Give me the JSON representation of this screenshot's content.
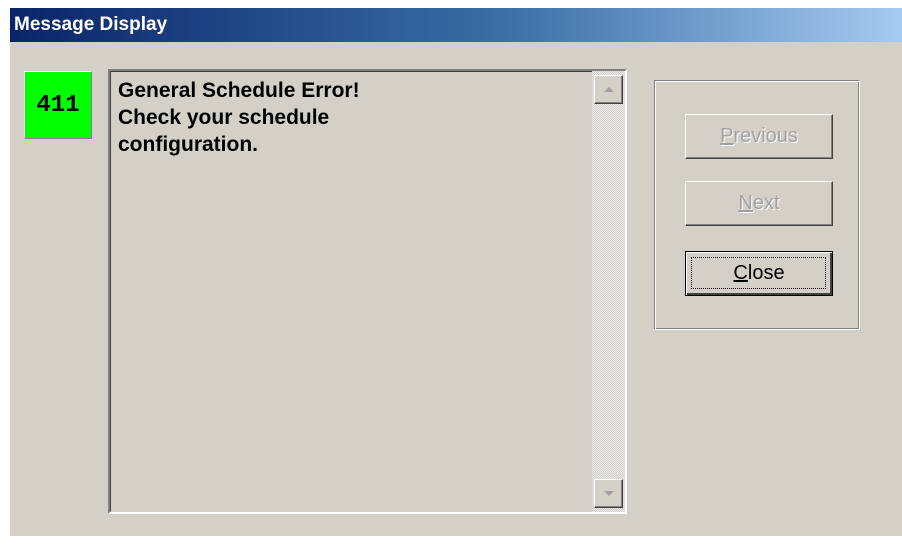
{
  "window": {
    "title": "Message Display"
  },
  "message": {
    "code": "411",
    "code_color": "#00ff00",
    "text": "General Schedule Error!\nCheck your schedule\nconfiguration."
  },
  "buttons": {
    "previous_label": "Previous",
    "next_label": "Next",
    "close_label": "Close",
    "previous_enabled": false,
    "next_enabled": false,
    "close_enabled": true
  },
  "scrollbar": {
    "up_icon": "scroll-up-arrow-icon",
    "down_icon": "scroll-down-arrow-icon"
  },
  "colors": {
    "titlebar_start": "#0a246a",
    "titlebar_end": "#a6caf0",
    "face": "#d4d0c8"
  }
}
